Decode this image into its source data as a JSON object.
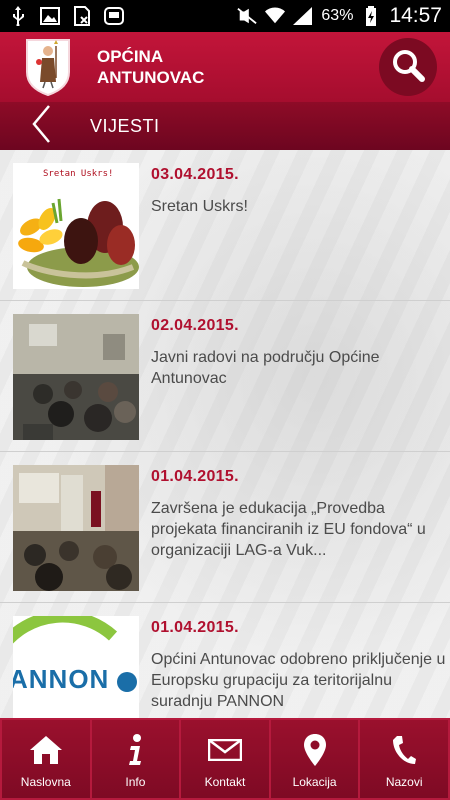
{
  "status_bar": {
    "battery": "63%",
    "time": "14:57",
    "icons": [
      "usb-icon",
      "image-icon",
      "no-sim-icon",
      "screen-icon",
      "mute-icon",
      "wifi-icon",
      "signal-icon",
      "battery-icon"
    ]
  },
  "header": {
    "title_line1": "OPĆINA",
    "title_line2": "ANTUNOVAC",
    "search_icon": "search-icon"
  },
  "section": {
    "title": "VIJESTI"
  },
  "news": [
    {
      "date": "03.04.2015.",
      "title": "Sretan Uskrs!",
      "thumb_caption": "Sretan Uskrs!"
    },
    {
      "date": "02.04.2015.",
      "title": "Javni radovi na području Općine Antunovac"
    },
    {
      "date": "01.04.2015.",
      "title": "Završena je edukacija „Provedba projekata financiranih iz EU fondova“ u organizaciji LAG-a Vuk..."
    },
    {
      "date": "01.04.2015.",
      "title": "Općini Antunovac odobreno priključenje u Europsku grupaciju za teritorijalnu suradnju PANNON",
      "thumb_caption": "ANNON"
    }
  ],
  "bottom_nav": [
    {
      "label": "Naslovna",
      "icon": "home-icon"
    },
    {
      "label": "Info",
      "icon": "info-icon"
    },
    {
      "label": "Kontakt",
      "icon": "mail-icon"
    },
    {
      "label": "Lokacija",
      "icon": "location-pin-icon"
    },
    {
      "label": "Nazovi",
      "icon": "phone-icon"
    }
  ],
  "colors": {
    "brand": "#b0102f",
    "header_dark": "#7c0a22",
    "text": "#4b4b4b"
  }
}
